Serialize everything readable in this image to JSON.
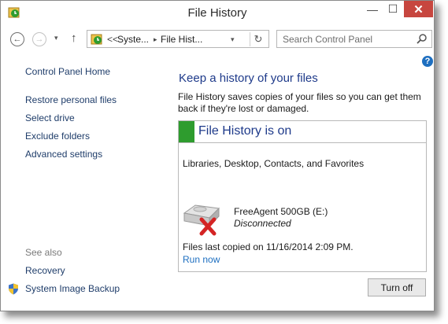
{
  "window": {
    "title": "File History",
    "minimize": "—",
    "maximize": "☐",
    "close": "✕"
  },
  "nav": {
    "back": "←",
    "forward": "→",
    "recent": "▾",
    "up": "↑",
    "address": {
      "prefix": "<<",
      "crumbs": [
        "Syste...",
        "File Hist..."
      ],
      "separator": "▸",
      "dropdown": "▾",
      "refresh": "↻"
    },
    "search": {
      "placeholder": "Search Control Panel"
    }
  },
  "help": "?",
  "left_nav": {
    "home": "Control Panel Home",
    "links": [
      "Restore personal files",
      "Select drive",
      "Exclude folders",
      "Advanced settings"
    ],
    "see_also_title": "See also",
    "see_also": [
      "Recovery",
      "System Image Backup"
    ]
  },
  "main": {
    "heading": "Keep a history of your files",
    "description": "File History saves copies of your files so you can get them back if they're lost or damaged.",
    "status_title": "File History is on",
    "folders": "Libraries, Desktop, Contacts, and Favorites",
    "drive": {
      "name": "FreeAgent 500GB (E:)",
      "status": "Disconnected"
    },
    "last_copied": "Files last copied on 11/16/2014 2:09 PM.",
    "run_now": "Run now",
    "turn_off": "Turn off"
  },
  "colors": {
    "accent_green": "#2e9c2e",
    "heading_blue": "#1e3a8a",
    "link_blue": "#1e6fc0",
    "close_red": "#c7463f"
  }
}
